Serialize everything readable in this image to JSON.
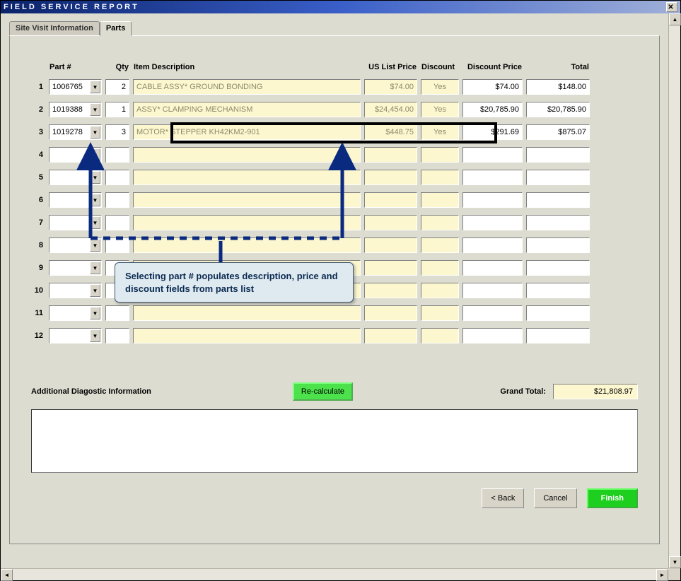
{
  "window": {
    "title": "FIELD SERVICE REPORT"
  },
  "tabs": {
    "site_visit": "Site Visit Information",
    "parts": "Parts"
  },
  "headers": {
    "part": "Part #",
    "qty": "Qty",
    "desc": "Item Description",
    "price": "US List Price",
    "discount": "Discount",
    "dprice": "Discount Price",
    "total": "Total"
  },
  "rows": [
    {
      "n": "1",
      "part": "1006765",
      "qty": "2",
      "desc": "CABLE ASSY* GROUND BONDING",
      "price": "$74.00",
      "discount": "Yes",
      "dprice": "$74.00",
      "total": "$148.00"
    },
    {
      "n": "2",
      "part": "1019388",
      "qty": "1",
      "desc": "ASSY* CLAMPING MECHANISM",
      "price": "$24,454.00",
      "discount": "Yes",
      "dprice": "$20,785.90",
      "total": "$20,785.90"
    },
    {
      "n": "3",
      "part": "1019278",
      "qty": "3",
      "desc": "MOTOR* STEPPER KH42KM2-901",
      "price": "$448.75",
      "discount": "Yes",
      "dprice": "$291.69",
      "total": "$875.07"
    },
    {
      "n": "4",
      "part": "",
      "qty": "",
      "desc": "",
      "price": "",
      "discount": "",
      "dprice": "",
      "total": ""
    },
    {
      "n": "5",
      "part": "",
      "qty": "",
      "desc": "",
      "price": "",
      "discount": "",
      "dprice": "",
      "total": ""
    },
    {
      "n": "6",
      "part": "",
      "qty": "",
      "desc": "",
      "price": "",
      "discount": "",
      "dprice": "",
      "total": ""
    },
    {
      "n": "7",
      "part": "",
      "qty": "",
      "desc": "",
      "price": "",
      "discount": "",
      "dprice": "",
      "total": ""
    },
    {
      "n": "8",
      "part": "",
      "qty": "",
      "desc": "",
      "price": "",
      "discount": "",
      "dprice": "",
      "total": ""
    },
    {
      "n": "9",
      "part": "",
      "qty": "",
      "desc": "",
      "price": "",
      "discount": "",
      "dprice": "",
      "total": ""
    },
    {
      "n": "10",
      "part": "",
      "qty": "",
      "desc": "",
      "price": "",
      "discount": "",
      "dprice": "",
      "total": ""
    },
    {
      "n": "11",
      "part": "",
      "qty": "",
      "desc": "",
      "price": "",
      "discount": "",
      "dprice": "",
      "total": ""
    },
    {
      "n": "12",
      "part": "",
      "qty": "",
      "desc": "",
      "price": "",
      "discount": "",
      "dprice": "",
      "total": ""
    }
  ],
  "callout": "Selecting part # populates description, price and discount fields from parts list",
  "addl_label": "Additional Diagostic Information",
  "recalc": "Re-calculate",
  "grand_label": "Grand Total:",
  "grand_value": "$21,808.97",
  "buttons": {
    "back": "< Back",
    "cancel": "Cancel",
    "finish": "Finish"
  }
}
